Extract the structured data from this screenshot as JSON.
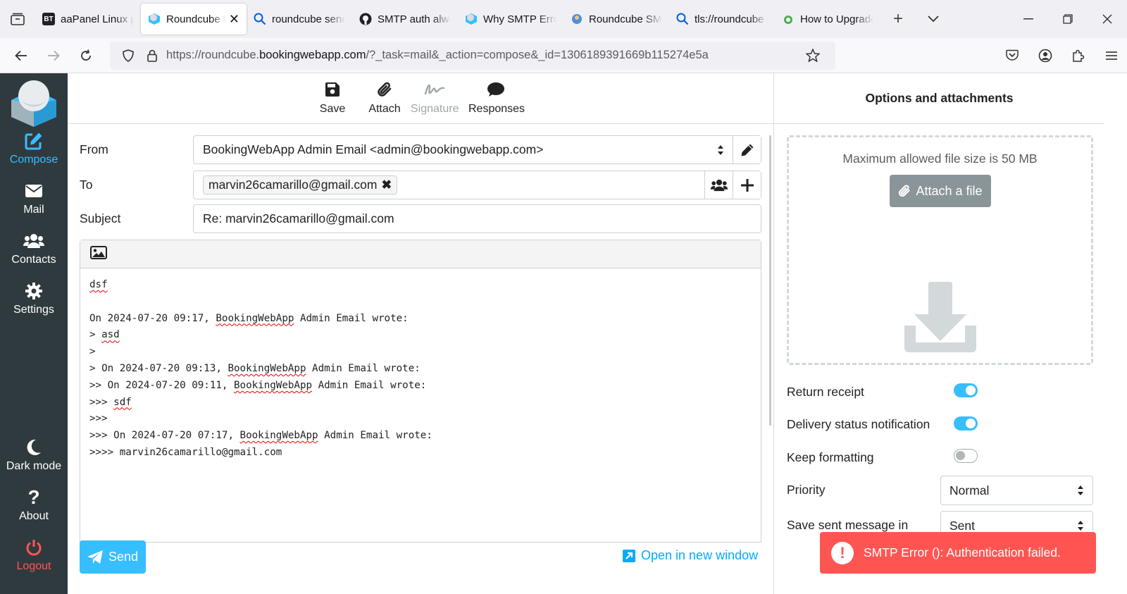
{
  "browser": {
    "tabs": [
      {
        "label": "aaPanel Linux panel",
        "icon": "bt-favicon"
      },
      {
        "label": "Roundcube Webmail",
        "icon": "roundcube-favicon",
        "active": true
      },
      {
        "label": "roundcube send error",
        "icon": "search-favicon"
      },
      {
        "label": "SMTP auth always fails",
        "icon": "github-favicon"
      },
      {
        "label": "Why SMTP Error",
        "icon": "roundcube-favicon"
      },
      {
        "label": "Roundcube SMTP",
        "icon": "site-favicon"
      },
      {
        "label": "tls://roundcube",
        "icon": "search-favicon"
      },
      {
        "label": "How to Upgrade",
        "icon": "site-favicon"
      }
    ],
    "favicon_bt": "BT",
    "url_prefix": "https://roundcube.",
    "url_host": "bookingwebapp.com",
    "url_path": "/?_task=mail&_action=compose&_id=1306189391669b115274e5a"
  },
  "sidebar": {
    "compose": "Compose",
    "mail": "Mail",
    "contacts": "Contacts",
    "settings": "Settings",
    "dark_mode": "Dark mode",
    "about": "About",
    "logout": "Logout"
  },
  "toolbar": {
    "save": "Save",
    "attach": "Attach",
    "signature": "Signature",
    "responses": "Responses"
  },
  "compose": {
    "from_label": "From",
    "from_value": "BookingWebApp Admin Email <admin@bookingwebapp.com>",
    "to_label": "To",
    "to_recipient": "marvin26camarillo@gmail.com",
    "subject_label": "Subject",
    "subject_value": "Re: marvin26camarillo@gmail.com",
    "body": {
      "l1": "dsf",
      "l2_pre": "On 2024-07-20 09:17, ",
      "l2_name": "BookingWebApp",
      "l2_post": " Admin Email wrote:",
      "l3_pre": "> ",
      "l3_word": "asd",
      "l4": ">",
      "l5_pre": "> On 2024-07-20 09:13, ",
      "l5_name": "BookingWebApp",
      "l5_post": " Admin Email wrote:",
      "l6_pre": ">> On 2024-07-20 09:11, ",
      "l6_name": "BookingWebApp",
      "l6_post": " Admin Email wrote:",
      "l7_pre": ">>> ",
      "l7_word": "sdf",
      "l8": ">>>",
      "l9_pre": ">>> On 2024-07-20 07:17, ",
      "l9_name": "BookingWebApp",
      "l9_post": " Admin Email wrote:",
      "l10": ">>>> marvin26camarillo@gmail.com"
    },
    "send": "Send",
    "open_new_window": "Open in new window"
  },
  "options": {
    "header": "Options and attachments",
    "max_size": "Maximum allowed file size is 50 MB",
    "attach_file": "Attach a file",
    "return_receipt": "Return receipt",
    "delivery_status": "Delivery status notification",
    "keep_formatting": "Keep formatting",
    "priority_label": "Priority",
    "priority_value": "Normal",
    "save_sent_label": "Save sent message in",
    "save_sent_value": "Sent"
  },
  "error": {
    "message": "SMTP Error (): Authentication failed."
  },
  "colors": {
    "accent": "#37beff",
    "sidebar": "#2f3a3f",
    "error": "#ff5552"
  }
}
